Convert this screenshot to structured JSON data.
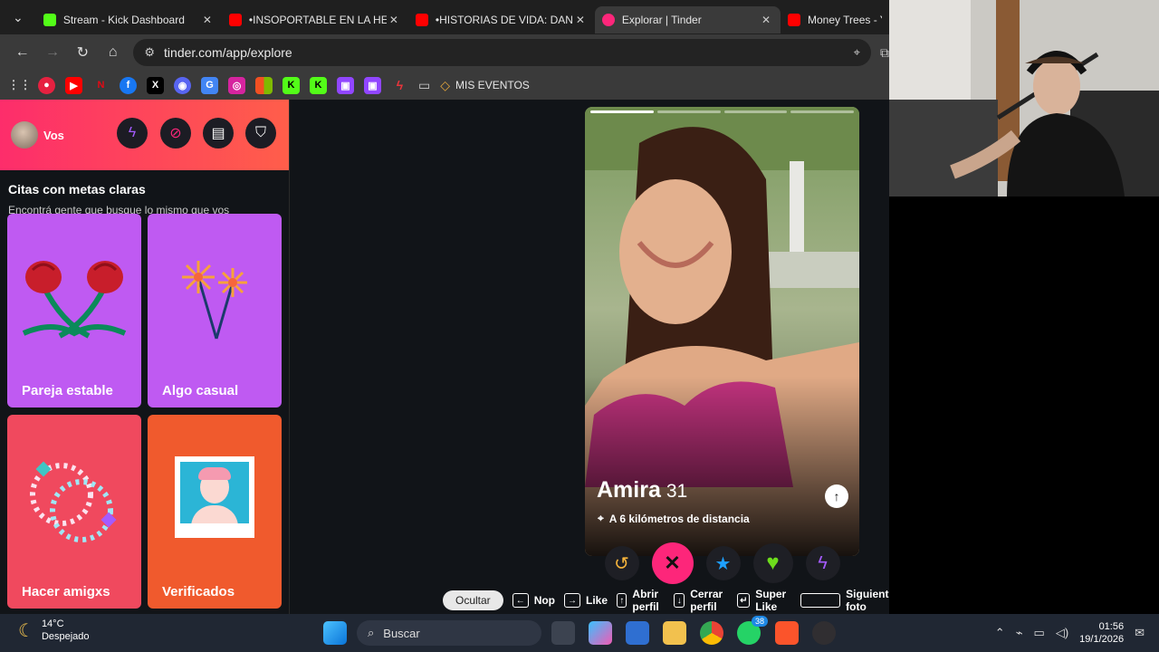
{
  "browser": {
    "tabs": [
      {
        "title": "Stream - Kick Dashboard",
        "favicon_color": "#53fc18",
        "glyph": "K",
        "active": false
      },
      {
        "title": "•INSOPORTABLE EN LA HEL",
        "favicon_color": "#ff0000",
        "glyph": "▶",
        "active": false
      },
      {
        "title": "•HISTORIAS DE VIDA: DANIE",
        "favicon_color": "#ff0000",
        "glyph": "▶",
        "active": false
      },
      {
        "title": "Explorar | Tinder",
        "favicon_color": "#fd267a",
        "glyph": "●",
        "active": true
      },
      {
        "title": "Money Trees - Yo",
        "favicon_color": "#ff0000",
        "glyph": "▶",
        "active": false
      }
    ],
    "close_glyph": "✕",
    "url": "tinder.com/app/explore",
    "bookmark_label": "MIS EVENTOS",
    "bookmark_icons": [
      {
        "name": "apps-grid-icon",
        "glyph": "⋮⋮",
        "color": "#3a3a3a"
      },
      {
        "name": "circle-play-icon",
        "glyph": "●",
        "color": "#e62140"
      },
      {
        "name": "youtube-icon",
        "glyph": "▶",
        "color": "#ff0000"
      },
      {
        "name": "netflix-icon",
        "glyph": "N",
        "color": "#b20710"
      },
      {
        "name": "facebook-icon",
        "glyph": "f",
        "color": "#1877f2"
      },
      {
        "name": "x-icon",
        "glyph": "X",
        "color": "#000000"
      },
      {
        "name": "discord-icon",
        "glyph": "◉",
        "color": "#5865f2"
      },
      {
        "name": "translate-icon",
        "glyph": "G",
        "color": "#4285f4"
      },
      {
        "name": "instagram-icon",
        "glyph": "◎",
        "color": "#d6249f"
      },
      {
        "name": "microsoft-icon",
        "glyph": "■",
        "color": "#7fba00"
      },
      {
        "name": "kick-icon",
        "glyph": "K",
        "color": "#53fc18"
      },
      {
        "name": "kick-icon-2",
        "glyph": "K",
        "color": "#53fc18"
      },
      {
        "name": "twitch-icon",
        "glyph": "▣",
        "color": "#9146ff"
      },
      {
        "name": "twitch-icon-2",
        "glyph": "▣",
        "color": "#9146ff"
      },
      {
        "name": "bolt-icon",
        "glyph": "ϟ",
        "color": "#e9343b"
      }
    ]
  },
  "sidebar": {
    "user_label": "Vos",
    "section_title": "Citas con metas claras",
    "section_subtitle": "Encontrá gente que busque lo mismo que vos",
    "cards": [
      {
        "label": "Pareja estable",
        "color": "#bf5af2"
      },
      {
        "label": "Algo casual",
        "color": "#bf5af2"
      },
      {
        "label": "Hacer amigxs",
        "color": "#f0495e"
      },
      {
        "label": "Verificados",
        "color": "#f05a2d"
      }
    ]
  },
  "profile": {
    "name": "Amira",
    "age": "31",
    "distance": "A 6 kilómetros de distancia",
    "photo_count": 4,
    "current_photo": 1
  },
  "actions": {
    "rewind_glyph": "↺",
    "nope_glyph": "✕",
    "superlike_glyph": "★",
    "like_glyph": "♥",
    "boost_glyph": "ϟ"
  },
  "hints": {
    "hide": "Ocultar",
    "nope": "Nop",
    "like": "Like",
    "open": "Abrir perfil",
    "close": "Cerrar perfil",
    "super": "Super Like",
    "next": "Siguiente foto"
  },
  "taskbar": {
    "temperature": "14°C",
    "weather": "Despejado",
    "search_placeholder": "Buscar",
    "time": "01:56",
    "date": "19/1/2026",
    "whatsapp_badge": "38"
  },
  "colors": {
    "tinder_pink": "#fd267a",
    "tinder_gradient_start": "#fd2d6b",
    "tinder_gradient_end": "#ff5e4a"
  }
}
